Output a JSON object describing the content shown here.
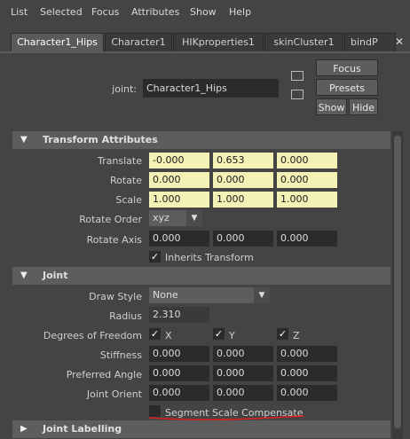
{
  "menu": [
    "List",
    "Selected",
    "Focus",
    "Attributes",
    "Show",
    "Help"
  ],
  "tabs": [
    "Character1_Hips",
    "Character1",
    "HIKproperties1",
    "skinCluster1",
    "bindP"
  ],
  "joint_label": "joint:",
  "joint_name": "Character1_Hips",
  "buttons": {
    "focus": "Focus",
    "presets": "Presets",
    "show": "Show",
    "hide": "Hide"
  },
  "transform": {
    "title": "Transform Attributes",
    "translate_label": "Translate",
    "translate": [
      "-0.000",
      "0.653",
      "0.000"
    ],
    "rotate_label": "Rotate",
    "rotate": [
      "0.000",
      "0.000",
      "0.000"
    ],
    "scale_label": "Scale",
    "scale": [
      "1.000",
      "1.000",
      "1.000"
    ],
    "rotate_order_label": "Rotate Order",
    "rotate_order": "xyz",
    "rotate_axis_label": "Rotate Axis",
    "rotate_axis": [
      "0.000",
      "0.000",
      "0.000"
    ],
    "inherits_label": "Inherits Transform"
  },
  "joint": {
    "title": "Joint",
    "draw_style_label": "Draw Style",
    "draw_style": "None",
    "radius_label": "Radius",
    "radius": "2.310",
    "dof_label": "Degrees of Freedom",
    "dof": [
      "X",
      "Y",
      "Z"
    ],
    "stiffness_label": "Stiffness",
    "stiffness": [
      "0.000",
      "0.000",
      "0.000"
    ],
    "preferred_label": "Preferred Angle",
    "preferred": [
      "0.000",
      "0.000",
      "0.000"
    ],
    "orient_label": "Joint Orient",
    "orient": [
      "0.000",
      "0.000",
      "0.000"
    ],
    "segment_label": "Segment Scale Compensate"
  },
  "labelling": {
    "title": "Joint Labelling"
  },
  "colors": {
    "highlight": "#f3f1b6",
    "annotation": "#e02020"
  }
}
